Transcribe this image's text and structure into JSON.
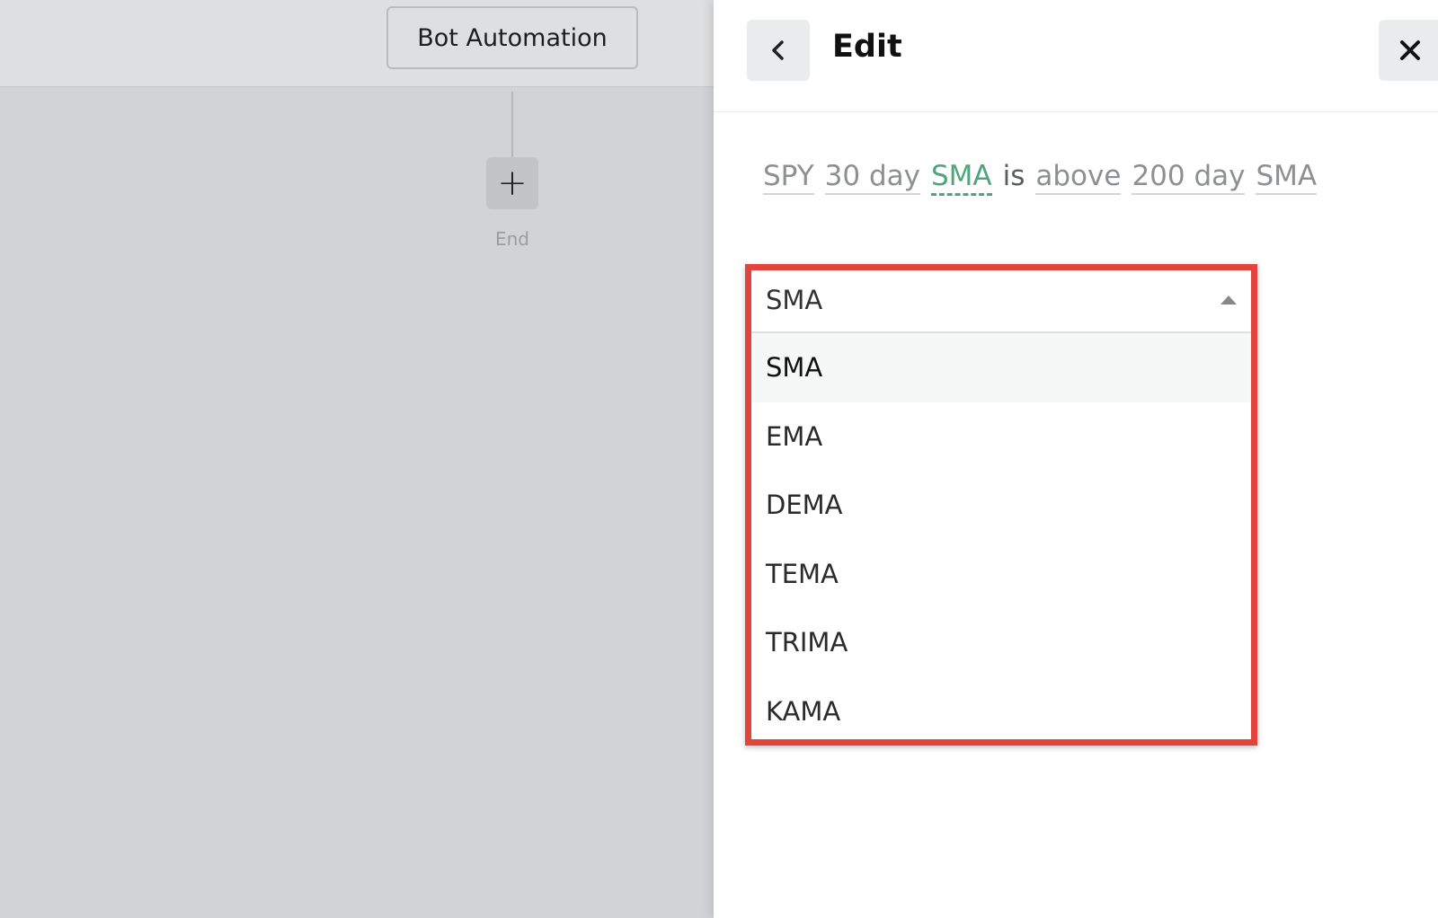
{
  "canvas": {
    "node_label": "Bot Automation",
    "add_label": "+",
    "end_label": "End"
  },
  "panel": {
    "title": "Edit",
    "back_icon": "chevron-left-icon",
    "close_icon": "close-icon"
  },
  "condition": {
    "tokens": [
      "SPY",
      "30 day",
      "SMA",
      "is",
      "above",
      "200 day",
      "SMA"
    ]
  },
  "dropdown": {
    "selected": "SMA",
    "options": [
      "SMA",
      "EMA",
      "DEMA",
      "TEMA",
      "TRIMA",
      "KAMA"
    ]
  },
  "colors": {
    "accent_green": "#4ea67a",
    "highlight_red": "#e0443a"
  }
}
